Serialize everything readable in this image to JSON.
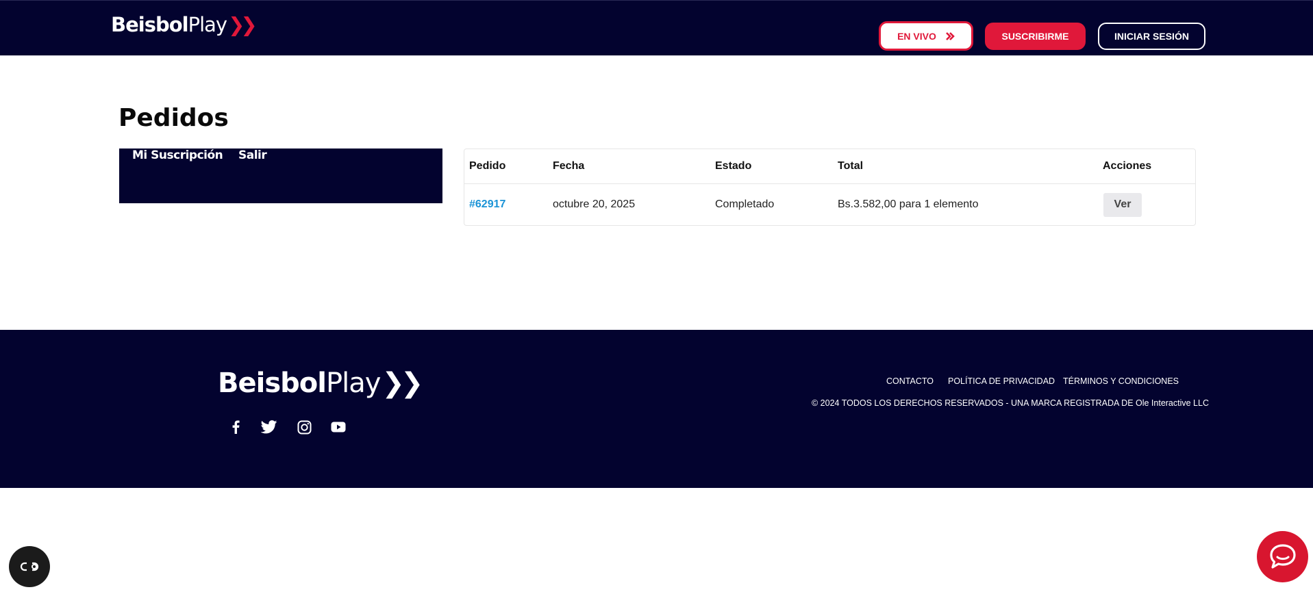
{
  "brand": {
    "name_bold": "Beisbol",
    "name_light": "Play",
    "accent_color": "#e0183a",
    "navy_color": "#03032f"
  },
  "header": {
    "live_label": "EN VIVO",
    "subscribe_label": "SUSCRIBIRME",
    "login_label": "INICIAR SESIÓN"
  },
  "page": {
    "title": "Pedidos"
  },
  "account_nav": {
    "items": [
      {
        "label": "Mi Suscripción"
      },
      {
        "label": "Salir"
      }
    ]
  },
  "orders": {
    "columns": [
      "Pedido",
      "Fecha",
      "Estado",
      "Total",
      "Acciones"
    ],
    "rows": [
      {
        "number": "#62917",
        "date": "octubre 20, 2025",
        "status": "Completado",
        "total": "Bs.3.582,00 para 1 elemento",
        "action": "Ver"
      }
    ]
  },
  "footer": {
    "social_icons": [
      "facebook-icon",
      "twitter-icon",
      "instagram-icon",
      "youtube-icon"
    ],
    "links": [
      "CONTACTO",
      "POLÍTICA DE PRIVACIDAD",
      "TÉRMINOS Y CONDICIONES"
    ],
    "copyright": "© 2024 TODOS LOS DERECHOS RESERVADOS - UNA MARCA REGISTRADA DE Ole Interactive LLC"
  },
  "widgets": {
    "accessibility_icon": "accessibility-toggle-icon",
    "chat_icon": "chat-bubble-icon"
  }
}
